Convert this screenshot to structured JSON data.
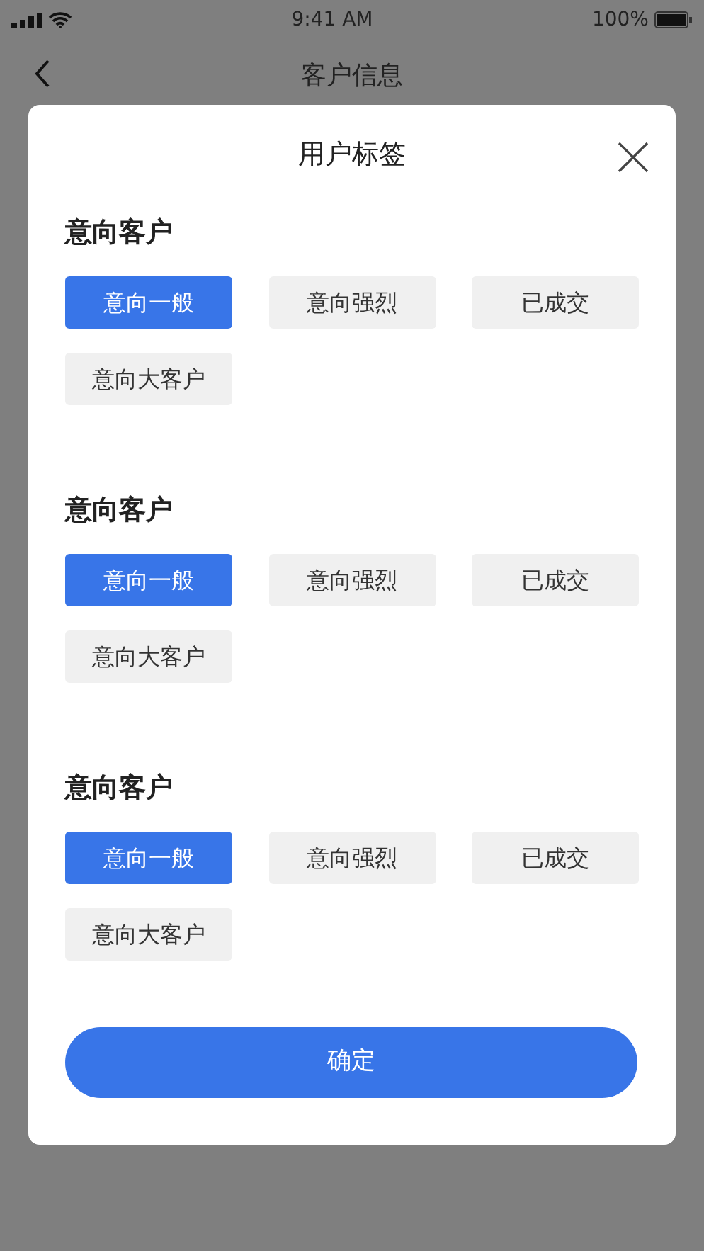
{
  "status_bar": {
    "time": "9:41 AM",
    "battery": "100%"
  },
  "nav_bar": {
    "title": "客户信息"
  },
  "dialog": {
    "title": "用户标签",
    "sections": [
      {
        "heading": "意向客户",
        "tags": [
          {
            "label": "意向一般",
            "selected": true
          },
          {
            "label": "意向强烈",
            "selected": false
          },
          {
            "label": "已成交",
            "selected": false
          },
          {
            "label": "意向大客户",
            "selected": false
          }
        ]
      },
      {
        "heading": "意向客户",
        "tags": [
          {
            "label": "意向一般",
            "selected": true
          },
          {
            "label": "意向强烈",
            "selected": false
          },
          {
            "label": "已成交",
            "selected": false
          },
          {
            "label": "意向大客户",
            "selected": false
          }
        ]
      },
      {
        "heading": "意向客户",
        "tags": [
          {
            "label": "意向一般",
            "selected": true
          },
          {
            "label": "意向强烈",
            "selected": false
          },
          {
            "label": "已成交",
            "selected": false
          },
          {
            "label": "意向大客户",
            "selected": false
          }
        ]
      }
    ],
    "confirm_button": "确定"
  }
}
